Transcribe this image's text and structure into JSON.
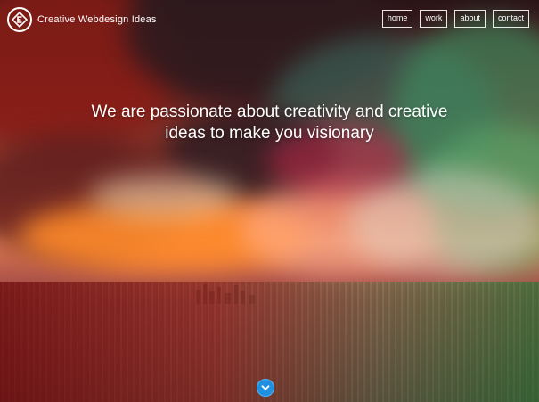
{
  "site": {
    "brand_name": "Creative Webdesign Ideas",
    "logo_icon": "diamond-e-logo"
  },
  "nav": {
    "items": [
      {
        "label": "home"
      },
      {
        "label": "work"
      },
      {
        "label": "about"
      },
      {
        "label": "contact"
      }
    ]
  },
  "hero": {
    "headline_line1": "We are passionate about creativity and creative",
    "headline_line2": "ideas to make you visionary",
    "scroll_icon": "chevron-down-icon",
    "scroll_button_color": "#1f8fe0"
  }
}
